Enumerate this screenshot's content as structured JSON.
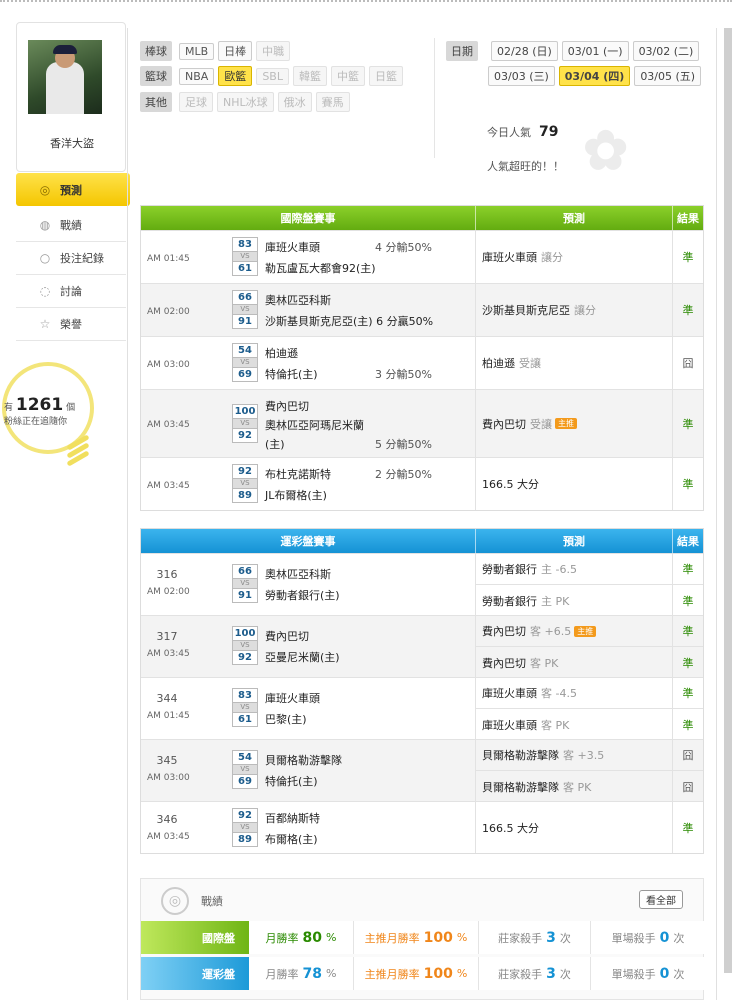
{
  "user": {
    "name": "香洋大盜"
  },
  "menu": [
    {
      "label": "預測",
      "icon": "target-icon",
      "active": true
    },
    {
      "label": "戰績",
      "icon": "record-icon"
    },
    {
      "label": "投注紀錄",
      "icon": "circle-icon"
    },
    {
      "label": "討論",
      "icon": "chat-icon"
    },
    {
      "label": "榮譽",
      "icon": "medal-icon"
    }
  ],
  "fans": {
    "prefix": "有",
    "count": "1261",
    "unit": "個",
    "text": "粉絲正在追隨你"
  },
  "filter": {
    "baseball": {
      "label": "棒球",
      "items": [
        "MLB",
        "日棒",
        "中職"
      ]
    },
    "basketball": {
      "label": "籃球",
      "items": [
        "NBA",
        "歐籃",
        "SBL",
        "韓籃",
        "中籃",
        "日籃"
      ]
    },
    "other": {
      "label": "其他",
      "items": [
        "足球",
        "NHL冰球",
        "俄冰",
        "賽馬"
      ]
    },
    "date": {
      "label": "日期",
      "items": [
        "02/28 (日)",
        "03/01 (一)",
        "03/02 (二)",
        "03/03 (三)",
        "03/04 (四)",
        "03/05 (五)"
      ]
    }
  },
  "popularity": {
    "label": "今日人氣",
    "value": "79",
    "note": "人氣超旺的！！"
  },
  "intl": {
    "headers": [
      "國際盤賽事",
      "預測",
      "結果"
    ],
    "rows": [
      {
        "time": "AM 01:45",
        "s1": "83",
        "s2": "61",
        "vs": "VS",
        "t1": "庫班火車頭",
        "t2": "勒瓦盧瓦大都會92(主)",
        "odds": "4 分輸50%",
        "pick": "庫班火車頭",
        "pick_sub": "讓分",
        "result": "準"
      },
      {
        "time": "AM 02:00",
        "s1": "66",
        "s2": "91",
        "vs": "VS",
        "t1": "奧林匹亞科斯",
        "t2": "沙斯基貝斯克尼亞(主) 6 分贏50%",
        "odds": "",
        "pick": "沙斯基貝斯克尼亞",
        "pick_sub": "讓分",
        "result": "準"
      },
      {
        "time": "AM 03:00",
        "s1": "54",
        "s2": "69",
        "vs": "VS",
        "t1": "柏迪遜",
        "t2": "特倫托(主)",
        "odds": "3 分輸50%",
        "pick": "柏迪遜",
        "pick_sub": "受讓",
        "result": "囧"
      },
      {
        "time": "AM 03:45",
        "s1": "100",
        "s2": "92",
        "vs": "VS",
        "t1": "費內巴切",
        "t2": "奧林匹亞阿瑪尼米蘭",
        "t3": "(主)",
        "odds": "5 分輸50%",
        "pick": "費內巴切",
        "pick_sub": "受讓",
        "hot": "主推",
        "result": "準"
      },
      {
        "time": "AM 03:45",
        "s1": "92",
        "s2": "89",
        "vs": "VS",
        "t1": "布杜克諾斯特",
        "t2": "JL布爾格(主)",
        "odds": "2 分輸50%",
        "pick": "166.5 大分",
        "pick_sub": "",
        "result": "準"
      }
    ]
  },
  "lottery": {
    "headers": [
      "運彩盤賽事",
      "預測",
      "結果"
    ],
    "rows": [
      {
        "num": "316",
        "time": "AM 02:00",
        "s1": "66",
        "s2": "91",
        "vs": "VS",
        "t1": "奧林匹亞科斯",
        "t2": "勞動者銀行(主)",
        "picks": [
          {
            "pick": "勞動者銀行",
            "sub": "主 -6.5",
            "result": "準"
          },
          {
            "pick": "勞動者銀行",
            "sub": "主 PK",
            "result": "準"
          }
        ]
      },
      {
        "num": "317",
        "time": "AM 03:45",
        "s1": "100",
        "s2": "92",
        "vs": "VS",
        "t1": "費內巴切",
        "t2": "亞曼尼米蘭(主)",
        "picks": [
          {
            "pick": "費內巴切",
            "sub": "客 +6.5",
            "hot": "主推",
            "result": "準"
          },
          {
            "pick": "費內巴切",
            "sub": "客 PK",
            "result": "準"
          }
        ]
      },
      {
        "num": "344",
        "time": "AM 01:45",
        "s1": "83",
        "s2": "61",
        "vs": "VS",
        "t1": "庫班火車頭",
        "t2": "巴黎(主)",
        "picks": [
          {
            "pick": "庫班火車頭",
            "sub": "客 -4.5",
            "result": "準"
          },
          {
            "pick": "庫班火車頭",
            "sub": "客 PK",
            "result": "準"
          }
        ]
      },
      {
        "num": "345",
        "time": "AM 03:00",
        "s1": "54",
        "s2": "69",
        "vs": "VS",
        "t1": "貝爾格勒游擊隊",
        "t2": "特倫托(主)",
        "picks": [
          {
            "pick": "貝爾格勒游擊隊",
            "sub": "客 +3.5",
            "result": "囧"
          },
          {
            "pick": "貝爾格勒游擊隊",
            "sub": "客 PK",
            "result": "囧"
          }
        ]
      },
      {
        "num": "346",
        "time": "AM 03:45",
        "s1": "92",
        "s2": "89",
        "vs": "VS",
        "t1": "百都納斯特",
        "t2": "布爾格(主)",
        "picks": [
          {
            "pick": "166.5 大分",
            "sub": "",
            "result": "準"
          }
        ]
      }
    ]
  },
  "stats": {
    "title": "戰績",
    "all_button": "看全部",
    "rows": [
      {
        "label": "國際盤",
        "month_rate_label": "月勝率",
        "month_rate": "80",
        "month_unit": "%",
        "main_rate_label": "主推月勝率",
        "main_rate": "100",
        "main_unit": "%",
        "banker_label": "莊家殺手",
        "banker": "3",
        "banker_unit": "次",
        "single_label": "單場殺手",
        "single": "0",
        "single_unit": "次"
      },
      {
        "label": "運彩盤",
        "month_rate_label": "月勝率",
        "month_rate": "78",
        "month_unit": "%",
        "main_rate_label": "主推月勝率",
        "main_rate": "100",
        "main_unit": "%",
        "banker_label": "莊家殺手",
        "banker": "3",
        "banker_unit": "次",
        "single_label": "單場殺手",
        "single": "0",
        "single_unit": "次"
      }
    ]
  }
}
